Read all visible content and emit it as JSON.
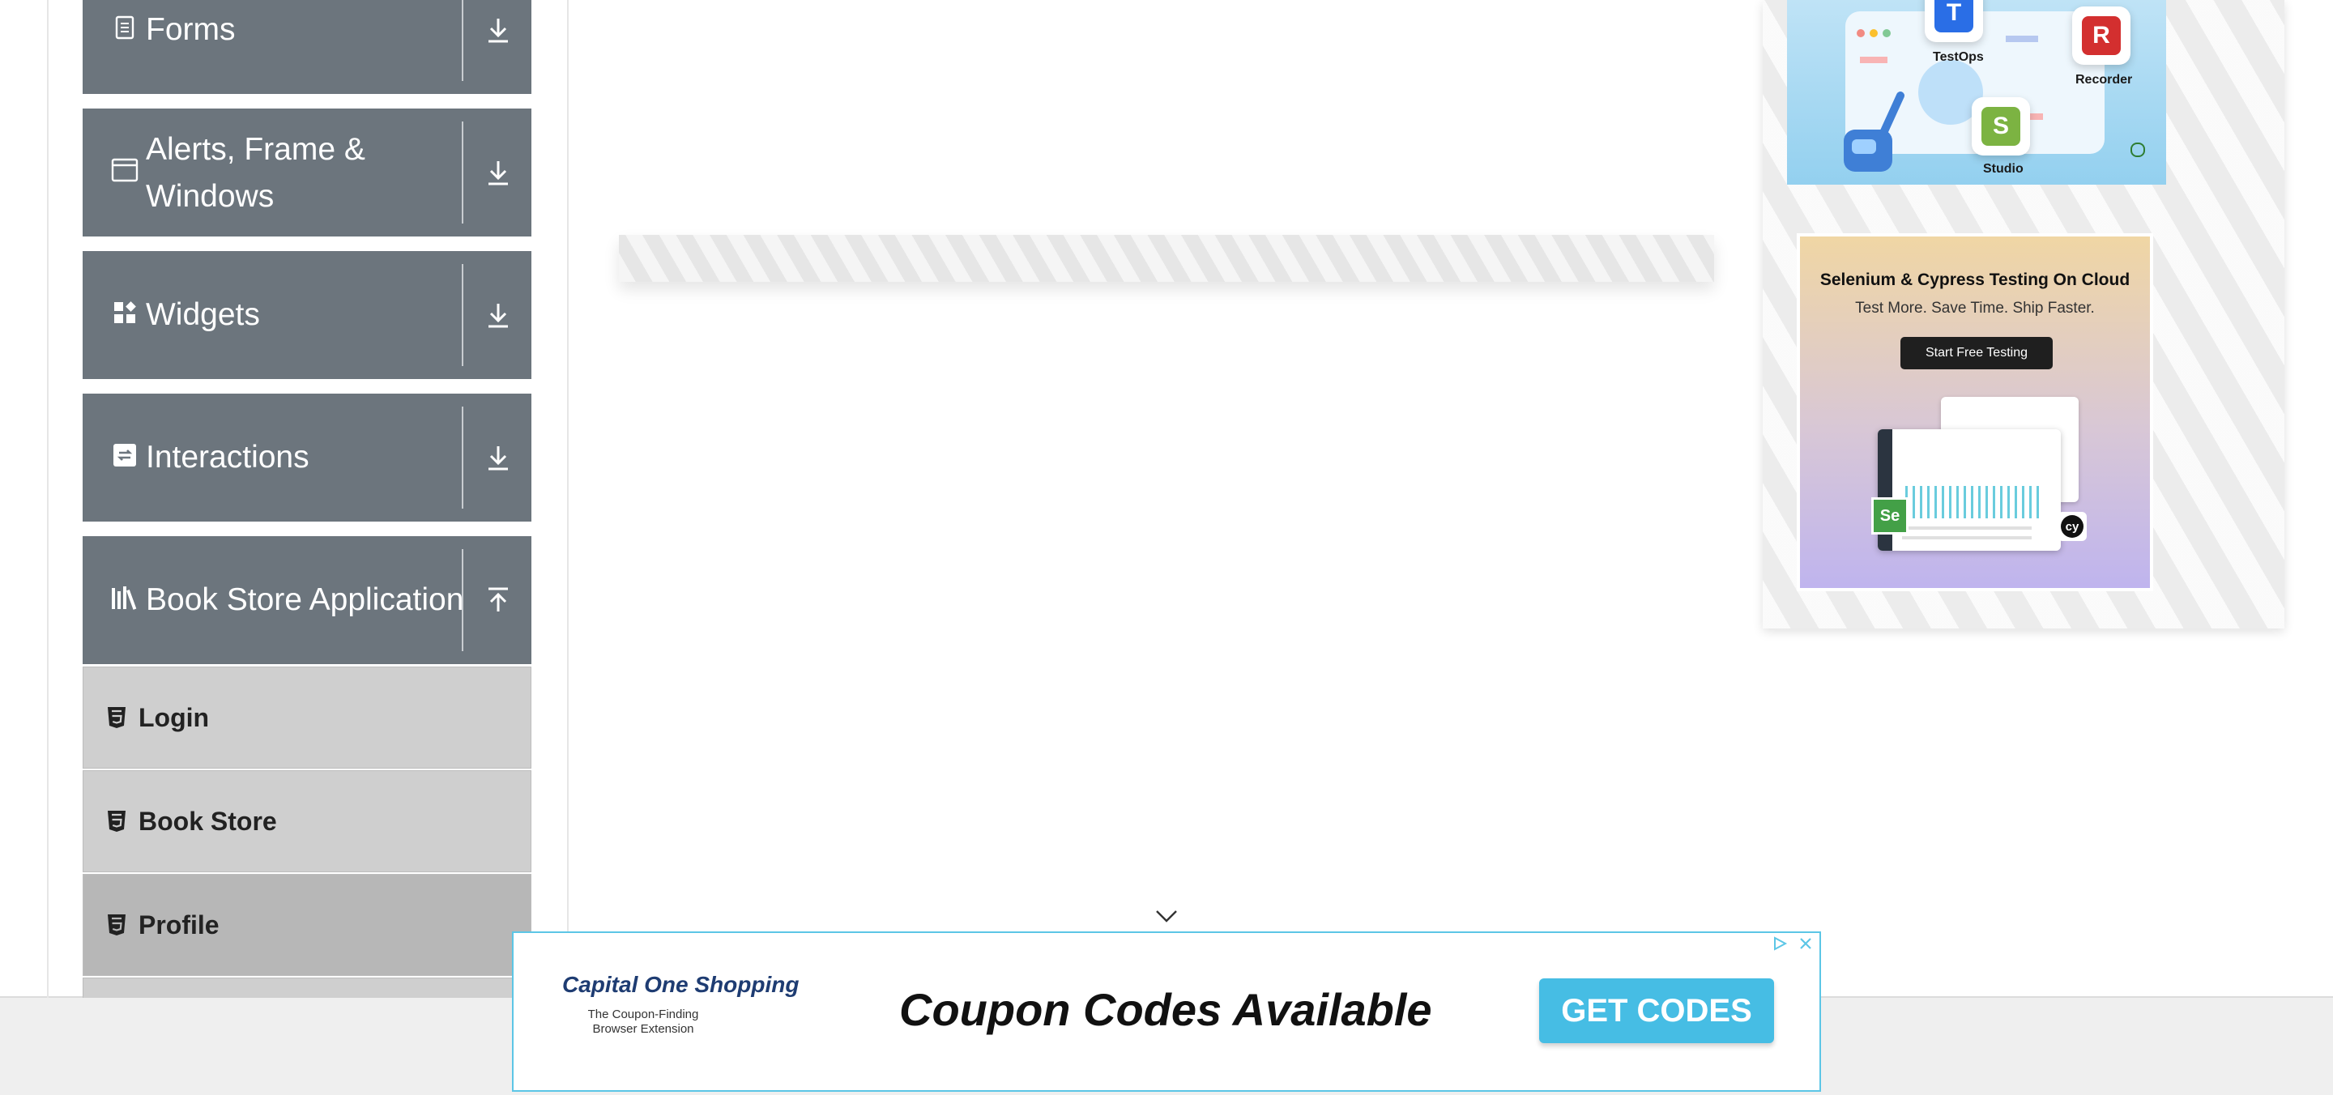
{
  "sidebar": {
    "groups": [
      {
        "title": "Forms",
        "icon": "form-icon",
        "state": "collapsed"
      },
      {
        "title": "Alerts, Frame & Windows",
        "icon": "window-icon",
        "state": "collapsed"
      },
      {
        "title": "Widgets",
        "icon": "widgets-icon",
        "state": "collapsed"
      },
      {
        "title": "Interactions",
        "icon": "interactions-icon",
        "state": "collapsed"
      },
      {
        "title": "Book Store Application",
        "icon": "books-icon",
        "state": "expanded"
      }
    ],
    "book_store_items": [
      {
        "label": "Login",
        "icon": "html5-icon"
      },
      {
        "label": "Book Store",
        "icon": "html5-icon"
      },
      {
        "label": "Profile",
        "icon": "html5-icon",
        "active": true
      }
    ]
  },
  "promos": {
    "katalon": {
      "apps": [
        "TestOps",
        "Recorder",
        "Studio"
      ]
    },
    "lambdatest": {
      "title": "Selenium & Cypress Testing On Cloud",
      "subtitle": "Test More. Save Time. Ship Faster.",
      "button": "Start Free Testing",
      "badges": [
        "Se",
        "cy"
      ]
    }
  },
  "ad_banner": {
    "brand": "Capital One Shopping",
    "brand_tagline_1": "The Coupon-Finding",
    "brand_tagline_2": "Browser Extension",
    "headline": "Coupon Codes Available",
    "cta": "GET CODES"
  },
  "colors": {
    "sidebar_group_bg": "#6c757d",
    "sidebar_item_bg": "#cfcfcf",
    "sidebar_item_active_bg": "#b7b7b7",
    "ad_cta_bg": "#46bde4",
    "ad_border": "#5cc6e6"
  }
}
